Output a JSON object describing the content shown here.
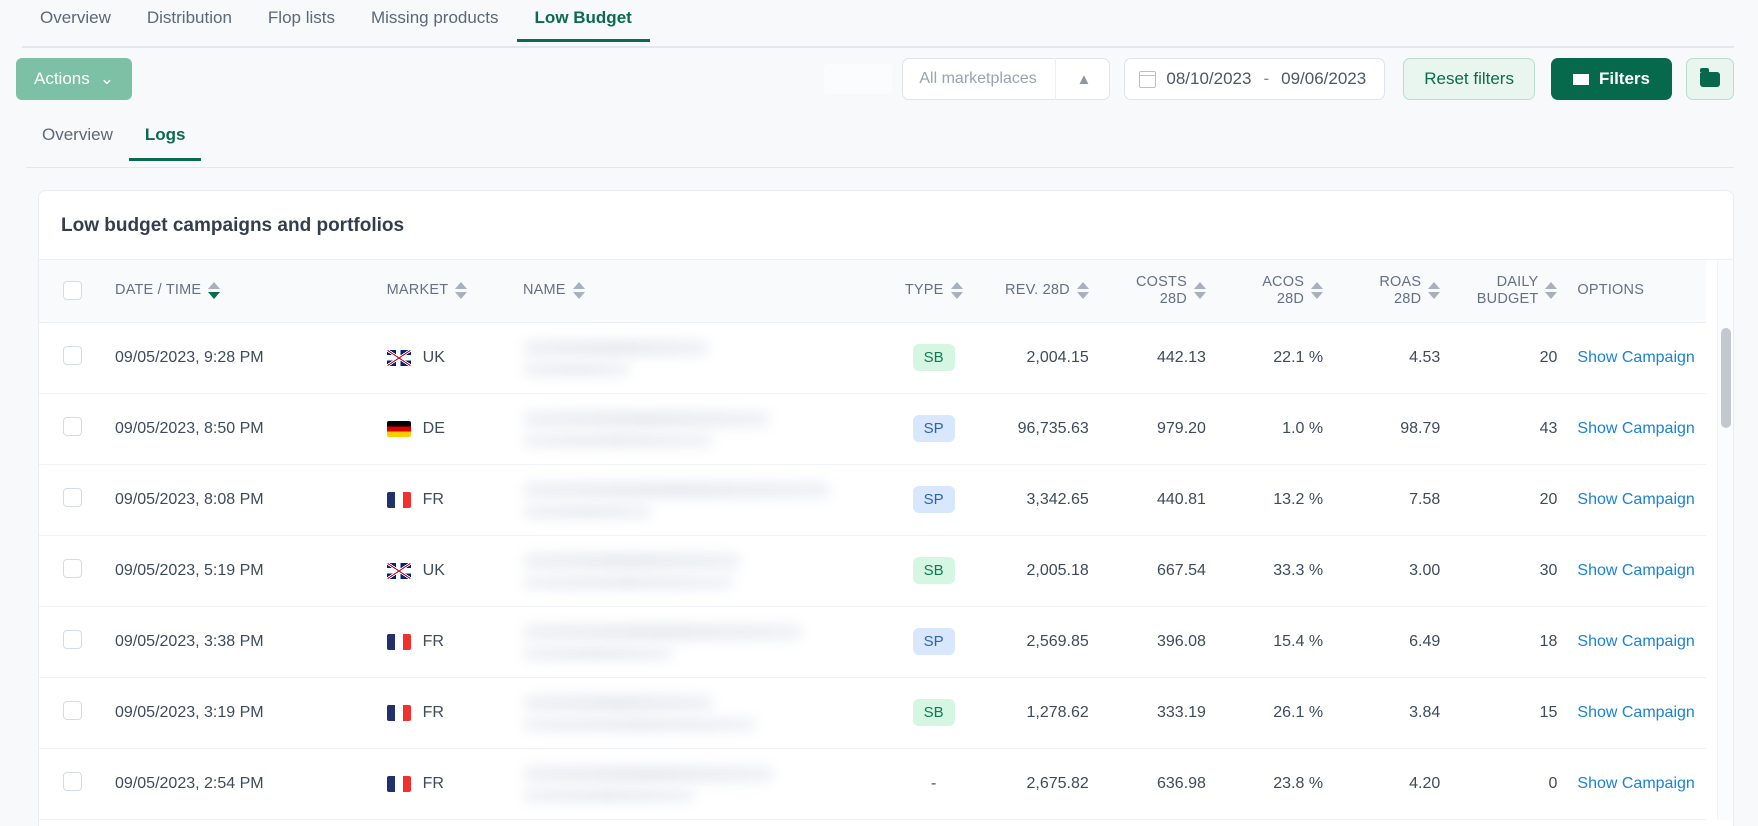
{
  "topnav": {
    "tabs": [
      {
        "label": "Overview",
        "active": false
      },
      {
        "label": "Distribution",
        "active": false
      },
      {
        "label": "Flop lists",
        "active": false
      },
      {
        "label": "Missing products",
        "active": false
      },
      {
        "label": "Low Budget",
        "active": true
      }
    ]
  },
  "toolbar": {
    "actions_label": "Actions",
    "actions_chevron": "chevron-down",
    "marketplace_value": "All marketplaces",
    "marketplace_chevron": "chevron-up",
    "date_start": "08/10/2023",
    "date_separator": "-",
    "date_end": "09/06/2023",
    "reset_label": "Reset filters",
    "filters_label": "Filters",
    "folder_icon": "folder-icon"
  },
  "subnav": {
    "tabs": [
      {
        "label": "Overview",
        "active": false
      },
      {
        "label": "Logs",
        "active": true
      }
    ]
  },
  "card": {
    "title": "Low budget campaigns and portfolios"
  },
  "table": {
    "columns": [
      {
        "key": "checkbox",
        "label": "",
        "sortable": false
      },
      {
        "key": "date",
        "label": "DATE / TIME",
        "sortable": true,
        "sort": "desc"
      },
      {
        "key": "market",
        "label": "MARKET",
        "sortable": true
      },
      {
        "key": "name",
        "label": "NAME",
        "sortable": true
      },
      {
        "key": "type",
        "label": "TYPE",
        "sortable": true
      },
      {
        "key": "rev",
        "label": "REV. 28D",
        "sortable": true
      },
      {
        "key": "costs",
        "label": "COSTS 28D",
        "label_l1": "COSTS",
        "label_l2": "28D",
        "sortable": true
      },
      {
        "key": "acos",
        "label": "ACOS 28D",
        "label_l1": "ACOS",
        "label_l2": "28D",
        "sortable": true
      },
      {
        "key": "roas",
        "label": "ROAS 28D",
        "label_l1": "ROAS",
        "label_l2": "28D",
        "sortable": true
      },
      {
        "key": "budget",
        "label": "DAILY BUDGET",
        "label_l1": "DAILY",
        "label_l2": "BUDGET",
        "sortable": true
      },
      {
        "key": "options",
        "label": "OPTIONS",
        "sortable": false
      }
    ],
    "option_link_label": "Show Campaign",
    "rows": [
      {
        "date": "09/05/2023, 9:28 PM",
        "market": "UK",
        "flag": "uk",
        "name": "",
        "type": "SB",
        "rev": "2,004.15",
        "costs": "442.13",
        "acos": "22.1 %",
        "acos_alert": false,
        "roas": "4.53",
        "budget": "20"
      },
      {
        "date": "09/05/2023, 8:50 PM",
        "market": "DE",
        "flag": "de",
        "name": "",
        "type": "SP",
        "rev": "96,735.63",
        "costs": "979.20",
        "acos": "1.0 %",
        "acos_alert": false,
        "roas": "98.79",
        "budget": "43"
      },
      {
        "date": "09/05/2023, 8:08 PM",
        "market": "FR",
        "flag": "fr",
        "name": "",
        "type": "SP",
        "rev": "3,342.65",
        "costs": "440.81",
        "acos": "13.2 %",
        "acos_alert": false,
        "roas": "7.58",
        "budget": "20"
      },
      {
        "date": "09/05/2023, 5:19 PM",
        "market": "UK",
        "flag": "uk",
        "name": "",
        "type": "SB",
        "rev": "2,005.18",
        "costs": "667.54",
        "acos": "33.3 %",
        "acos_alert": true,
        "roas": "3.00",
        "budget": "30"
      },
      {
        "date": "09/05/2023, 3:38 PM",
        "market": "FR",
        "flag": "fr",
        "name": "",
        "type": "SP",
        "rev": "2,569.85",
        "costs": "396.08",
        "acos": "15.4 %",
        "acos_alert": false,
        "roas": "6.49",
        "budget": "18"
      },
      {
        "date": "09/05/2023, 3:19 PM",
        "market": "FR",
        "flag": "fr",
        "name": "",
        "type": "SB",
        "rev": "1,278.62",
        "costs": "333.19",
        "acos": "26.1 %",
        "acos_alert": false,
        "roas": "3.84",
        "budget": "15"
      },
      {
        "date": "09/05/2023, 2:54 PM",
        "market": "FR",
        "flag": "fr",
        "name": "",
        "type": "-",
        "rev": "2,675.82",
        "costs": "636.98",
        "acos": "23.8 %",
        "acos_alert": false,
        "roas": "4.20",
        "budget": "0"
      }
    ]
  },
  "colors": {
    "brand_green": "#07694c",
    "accent_link": "#1a82d8",
    "alert_orange": "#f5a623",
    "pill_sb_bg": "#d4f6e2",
    "pill_sp_bg": "#d8e7fb"
  }
}
